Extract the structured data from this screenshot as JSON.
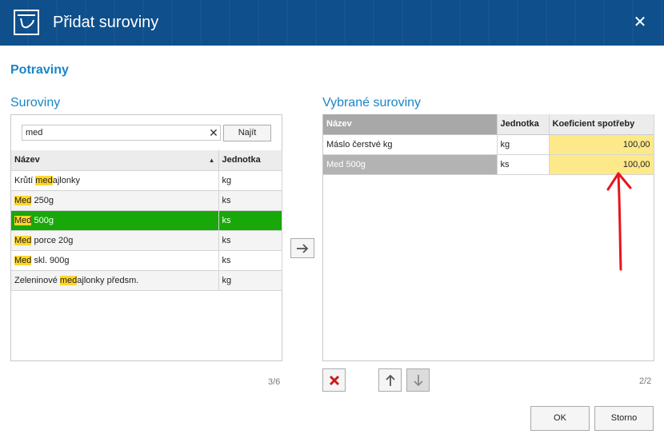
{
  "window": {
    "title": "Přidat suroviny",
    "close_glyph": "✕"
  },
  "section": {
    "title": "Potraviny"
  },
  "left_pane": {
    "title": "Suroviny",
    "search": {
      "value": "med",
      "clear_glyph": "✕",
      "find_label": "Najít"
    },
    "columns": [
      "Název",
      "Jednotka"
    ],
    "sort_glyph": "▲",
    "rows": [
      {
        "pre": "Krůtí ",
        "hl": "med",
        "post": "ajlonky",
        "unit": "kg"
      },
      {
        "pre": "",
        "hl": "Med",
        "post": " 250g",
        "unit": "ks"
      },
      {
        "pre": "",
        "hl": "Med",
        "post": " 500g",
        "unit": "ks",
        "selected": true
      },
      {
        "pre": "",
        "hl": "Med",
        "post": " porce 20g",
        "unit": "ks"
      },
      {
        "pre": "",
        "hl": "Med",
        "post": " skl. 900g",
        "unit": "ks"
      },
      {
        "pre": "Zeleninové ",
        "hl": "med",
        "post": "ajlonky  předsm.",
        "unit": "kg"
      }
    ],
    "counter": "3/6"
  },
  "right_pane": {
    "title": "Vybrané suroviny",
    "columns": [
      "Název",
      "Jednotka",
      "Koeficient spotřeby"
    ],
    "rows": [
      {
        "name": "Máslo čerstvé kg",
        "unit": "kg",
        "coef": "100,00"
      },
      {
        "name": "Med 500g",
        "unit": "ks",
        "coef": "100,00",
        "selected": true
      }
    ],
    "counter": "2/2"
  },
  "buttons": {
    "ok": "OK",
    "cancel": "Storno"
  },
  "icons": {
    "app": "scale-icon",
    "move": "arrow-right-icon",
    "remove": "red-x-icon",
    "up": "arrow-up-icon",
    "down": "arrow-down-icon"
  },
  "colors": {
    "titlebar": "#0e4f8c",
    "accent": "#1a85c8",
    "selected_row": "#19a80a",
    "highlight": "#ffd62e",
    "coef_cell": "#fde98a",
    "remove": "#d01818",
    "annotation_arrow": "#e8141c"
  }
}
